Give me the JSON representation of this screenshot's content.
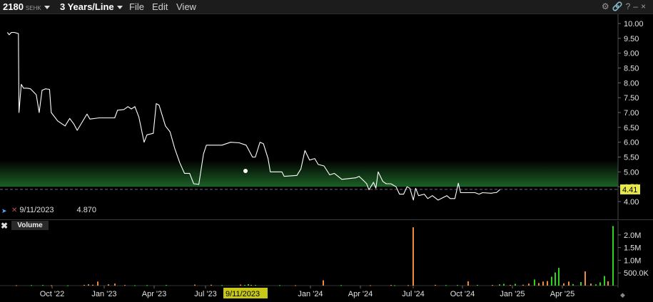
{
  "toolbar": {
    "symbol": "2180",
    "exchange": "SEHK",
    "period": "3 Years/Line",
    "menus": [
      "File",
      "Edit",
      "View"
    ],
    "icons": [
      "gear-icon",
      "link-icon",
      "help-icon",
      "minimize-icon",
      "close-icon"
    ]
  },
  "crosshair": {
    "date": "9/11/2023",
    "value": "4.870",
    "axis_label": "9/11/2023"
  },
  "volume_panel": {
    "title": "Volume",
    "close_glyph": "✖"
  },
  "colors": {
    "price_line": "#ffffff",
    "band": "#1f6b2a",
    "up_volume": "#2fd21f",
    "down_volume": "#f28a3c",
    "last_price_badge": "#e8e84a"
  },
  "chart_data": [
    {
      "type": "line",
      "title": "",
      "xlabel": "",
      "ylabel": "",
      "ylim": [
        3.6,
        10.3
      ],
      "yticks": [
        "10.00",
        "9.50",
        "9.00",
        "8.50",
        "8.00",
        "7.50",
        "7.00",
        "6.50",
        "6.00",
        "5.50",
        "5.00",
        "4.50",
        "4.00"
      ],
      "xticks": [
        "Oct '22",
        "Jan '23",
        "Apr '23",
        "Jul '23",
        "Jan '24",
        "Apr '24",
        "Jul '24",
        "Oct '24",
        "Jan '25",
        "Apr '25"
      ],
      "last_price": "4.41",
      "band": [
        4.5,
        5.4
      ],
      "series": [
        {
          "name": "",
          "points": [
            [
              "2022-08-25",
              9.7
            ],
            [
              "2022-08-28",
              9.62
            ],
            [
              "2022-09-01",
              9.7
            ],
            [
              "2022-09-06",
              9.7
            ],
            [
              "2022-09-13",
              9.66
            ],
            [
              "2022-09-14",
              7.0
            ],
            [
              "2022-09-18",
              7.95
            ],
            [
              "2022-09-22",
              7.82
            ],
            [
              "2022-09-28",
              7.82
            ],
            [
              "2022-10-04",
              7.8
            ],
            [
              "2022-10-14",
              7.6
            ],
            [
              "2022-10-19",
              7.0
            ],
            [
              "2022-10-24",
              7.75
            ],
            [
              "2022-10-30",
              7.8
            ],
            [
              "2022-11-06",
              7.78
            ],
            [
              "2022-11-09",
              7.0
            ],
            [
              "2022-11-20",
              6.72
            ],
            [
              "2022-12-03",
              6.55
            ],
            [
              "2022-12-11",
              6.8
            ],
            [
              "2022-12-18",
              6.62
            ],
            [
              "2022-12-24",
              6.4
            ],
            [
              "2023-01-10",
              6.95
            ],
            [
              "2023-01-15",
              6.78
            ],
            [
              "2023-01-31",
              6.82
            ],
            [
              "2023-02-27",
              6.82
            ],
            [
              "2023-03-04",
              7.08
            ],
            [
              "2023-03-15",
              7.1
            ],
            [
              "2023-03-22",
              7.2
            ],
            [
              "2023-03-28",
              7.12
            ],
            [
              "2023-04-03",
              7.2
            ],
            [
              "2023-04-10",
              6.85
            ],
            [
              "2023-04-19",
              6.0
            ],
            [
              "2023-04-24",
              6.25
            ],
            [
              "2023-05-05",
              6.3
            ],
            [
              "2023-05-10",
              7.3
            ],
            [
              "2023-05-15",
              7.25
            ],
            [
              "2023-05-26",
              6.55
            ],
            [
              "2023-06-03",
              6.35
            ],
            [
              "2023-06-11",
              5.8
            ],
            [
              "2023-06-20",
              5.3
            ],
            [
              "2023-06-28",
              4.95
            ],
            [
              "2023-07-07",
              4.95
            ],
            [
              "2023-07-14",
              4.6
            ],
            [
              "2023-07-23",
              4.58
            ],
            [
              "2023-07-31",
              5.6
            ],
            [
              "2023-08-05",
              5.9
            ],
            [
              "2023-09-01",
              5.9
            ],
            [
              "2023-09-16",
              6.0
            ],
            [
              "2023-10-01",
              5.98
            ],
            [
              "2023-10-13",
              5.9
            ],
            [
              "2023-10-24",
              5.5
            ],
            [
              "2023-10-29",
              5.5
            ],
            [
              "2023-11-06",
              6.0
            ],
            [
              "2023-11-12",
              5.95
            ],
            [
              "2023-11-20",
              5.45
            ],
            [
              "2023-11-24",
              5.0
            ],
            [
              "2023-12-14",
              5.0
            ],
            [
              "2023-12-18",
              4.85
            ],
            [
              "2024-01-09",
              4.88
            ],
            [
              "2024-01-16",
              5.1
            ],
            [
              "2024-01-23",
              5.72
            ],
            [
              "2024-01-31",
              5.4
            ],
            [
              "2024-02-09",
              5.45
            ],
            [
              "2024-02-15",
              5.25
            ],
            [
              "2024-02-25",
              5.2
            ],
            [
              "2024-03-06",
              4.9
            ],
            [
              "2024-03-14",
              4.95
            ],
            [
              "2024-03-27",
              4.75
            ],
            [
              "2024-04-20",
              4.8
            ],
            [
              "2024-04-26",
              4.85
            ],
            [
              "2024-05-04",
              4.7
            ],
            [
              "2024-05-09",
              4.6
            ],
            [
              "2024-05-13",
              4.4
            ],
            [
              "2024-05-21",
              4.65
            ],
            [
              "2024-05-25",
              4.45
            ],
            [
              "2024-05-29",
              5.0
            ],
            [
              "2024-06-06",
              4.68
            ],
            [
              "2024-06-12",
              4.6
            ],
            [
              "2024-06-20",
              4.6
            ],
            [
              "2024-06-29",
              4.5
            ],
            [
              "2024-07-05",
              4.25
            ],
            [
              "2024-07-12",
              4.25
            ],
            [
              "2024-07-18",
              4.5
            ],
            [
              "2024-07-23",
              4.45
            ],
            [
              "2024-07-29",
              4.05
            ],
            [
              "2024-08-02",
              4.45
            ],
            [
              "2024-08-07",
              4.2
            ],
            [
              "2024-08-17",
              4.25
            ],
            [
              "2024-08-23",
              4.1
            ],
            [
              "2024-08-31",
              4.2
            ],
            [
              "2024-09-10",
              4.05
            ],
            [
              "2024-09-25",
              4.2
            ],
            [
              "2024-10-01",
              4.1
            ],
            [
              "2024-10-09",
              4.1
            ],
            [
              "2024-10-15",
              4.62
            ],
            [
              "2024-10-19",
              4.3
            ],
            [
              "2024-11-13",
              4.3
            ],
            [
              "2024-11-20",
              4.25
            ],
            [
              "2024-11-26",
              4.3
            ],
            [
              "2024-12-11",
              4.28
            ],
            [
              "2024-12-17",
              4.3
            ],
            [
              "2024-12-20",
              4.3
            ],
            [
              "2024-12-26",
              4.4
            ]
          ]
        }
      ]
    },
    {
      "type": "bar",
      "title": "Volume",
      "ylim": [
        0,
        2500000
      ],
      "yticks": [
        "2.0M",
        "1.5M",
        "1.0M",
        "500.0K"
      ],
      "bars": [
        {
          "x": 23,
          "v": 15000,
          "c": "d"
        },
        {
          "x": 44,
          "v": 20000,
          "c": "u"
        },
        {
          "x": 60,
          "v": 25000,
          "c": "u"
        },
        {
          "x": 72,
          "v": 15000,
          "c": "d"
        },
        {
          "x": 95,
          "v": 10000,
          "c": "u"
        },
        {
          "x": 118,
          "v": 30000,
          "c": "d"
        },
        {
          "x": 124,
          "v": 50000,
          "c": "d"
        },
        {
          "x": 130,
          "v": 35000,
          "c": "d"
        },
        {
          "x": 137,
          "v": 160000,
          "c": "d"
        },
        {
          "x": 152,
          "v": 50000,
          "c": "d"
        },
        {
          "x": 161,
          "v": 80000,
          "c": "d"
        },
        {
          "x": 175,
          "v": 25000,
          "c": "d"
        },
        {
          "x": 189,
          "v": 15000,
          "c": "u"
        },
        {
          "x": 206,
          "v": 20000,
          "c": "u"
        },
        {
          "x": 233,
          "v": 25000,
          "c": "u"
        },
        {
          "x": 273,
          "v": 40000,
          "c": "d"
        },
        {
          "x": 296,
          "v": 35000,
          "c": "d"
        },
        {
          "x": 311,
          "v": 20000,
          "c": "u"
        },
        {
          "x": 337,
          "v": 40000,
          "c": "d"
        },
        {
          "x": 343,
          "v": 25000,
          "c": "u"
        },
        {
          "x": 348,
          "v": 55000,
          "c": "u"
        },
        {
          "x": 352,
          "v": 30000,
          "c": "d"
        },
        {
          "x": 358,
          "v": 25000,
          "c": "u"
        },
        {
          "x": 392,
          "v": 20000,
          "c": "u"
        },
        {
          "x": 414,
          "v": 15000,
          "c": "d"
        },
        {
          "x": 453,
          "v": 210000,
          "c": "d"
        },
        {
          "x": 478,
          "v": 20000,
          "c": "u"
        },
        {
          "x": 519,
          "v": 15000,
          "c": "d"
        },
        {
          "x": 548,
          "v": 25000,
          "c": "d"
        },
        {
          "x": 553,
          "v": 15000,
          "c": "u"
        },
        {
          "x": 572,
          "v": 20000,
          "c": "d"
        },
        {
          "x": 579,
          "v": 2300000,
          "c": "d"
        },
        {
          "x": 610,
          "v": 30000,
          "c": "d"
        },
        {
          "x": 625,
          "v": 20000,
          "c": "u"
        },
        {
          "x": 641,
          "v": 25000,
          "c": "u"
        },
        {
          "x": 656,
          "v": 170000,
          "c": "d"
        },
        {
          "x": 669,
          "v": 30000,
          "c": "u"
        },
        {
          "x": 690,
          "v": 25000,
          "c": "d"
        },
        {
          "x": 700,
          "v": 50000,
          "c": "u"
        },
        {
          "x": 706,
          "v": 70000,
          "c": "u"
        },
        {
          "x": 715,
          "v": 30000,
          "c": "d"
        },
        {
          "x": 722,
          "v": 70000,
          "c": "u"
        },
        {
          "x": 733,
          "v": 35000,
          "c": "d"
        },
        {
          "x": 741,
          "v": 80000,
          "c": "d"
        },
        {
          "x": 749,
          "v": 240000,
          "c": "u"
        },
        {
          "x": 755,
          "v": 100000,
          "c": "d"
        },
        {
          "x": 761,
          "v": 160000,
          "c": "d"
        },
        {
          "x": 767,
          "v": 180000,
          "c": "d"
        },
        {
          "x": 773,
          "v": 350000,
          "c": "u"
        },
        {
          "x": 778,
          "v": 520000,
          "c": "u"
        },
        {
          "x": 783,
          "v": 700000,
          "c": "u"
        },
        {
          "x": 790,
          "v": 90000,
          "c": "d"
        },
        {
          "x": 797,
          "v": 160000,
          "c": "d"
        },
        {
          "x": 803,
          "v": 60000,
          "c": "u"
        },
        {
          "x": 814,
          "v": 140000,
          "c": "u"
        },
        {
          "x": 820,
          "v": 560000,
          "c": "d"
        },
        {
          "x": 828,
          "v": 80000,
          "c": "d"
        },
        {
          "x": 835,
          "v": 50000,
          "c": "u"
        },
        {
          "x": 841,
          "v": 130000,
          "c": "u"
        },
        {
          "x": 847,
          "v": 380000,
          "c": "u"
        },
        {
          "x": 852,
          "v": 170000,
          "c": "d"
        },
        {
          "x": 859,
          "v": 2350000,
          "c": "u"
        }
      ]
    }
  ]
}
